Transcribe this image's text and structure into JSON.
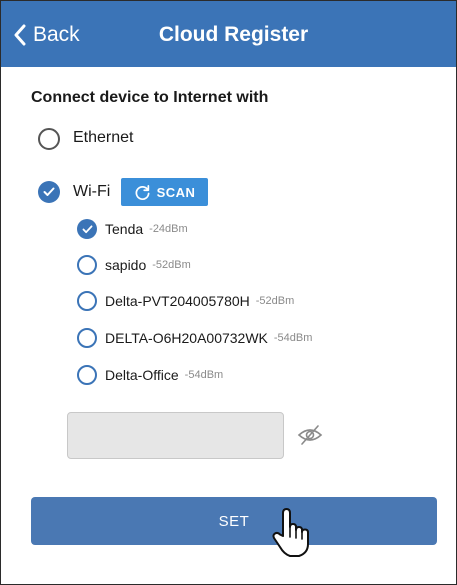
{
  "header": {
    "back_label": "Back",
    "title": "Cloud Register"
  },
  "connect": {
    "heading": "Connect device to Internet with",
    "options": [
      {
        "label": "Ethernet",
        "selected": false
      },
      {
        "label": "Wi-Fi",
        "selected": true
      }
    ],
    "scan_label": "SCAN"
  },
  "networks": [
    {
      "name": "Tenda",
      "signal": "-24dBm",
      "selected": true
    },
    {
      "name": "sapido",
      "signal": "-52dBm",
      "selected": false
    },
    {
      "name": "Delta-PVT204005780H",
      "signal": "-52dBm",
      "selected": false
    },
    {
      "name": "DELTA-O6H20A00732WK",
      "signal": "-54dBm",
      "selected": false
    },
    {
      "name": "Delta-Office",
      "signal": "-54dBm",
      "selected": false
    }
  ],
  "password": {
    "value": "",
    "placeholder": ""
  },
  "set_label": "SET",
  "icons": {
    "back": "chevron-left-icon",
    "scan": "refresh-icon",
    "eye": "eye-slash-icon",
    "pointer": "hand-pointer-icon"
  },
  "colors": {
    "header": "#3b74b7",
    "accent": "#3b74b7",
    "scan": "#3b8fd9",
    "set_button": "#4a78b3"
  }
}
